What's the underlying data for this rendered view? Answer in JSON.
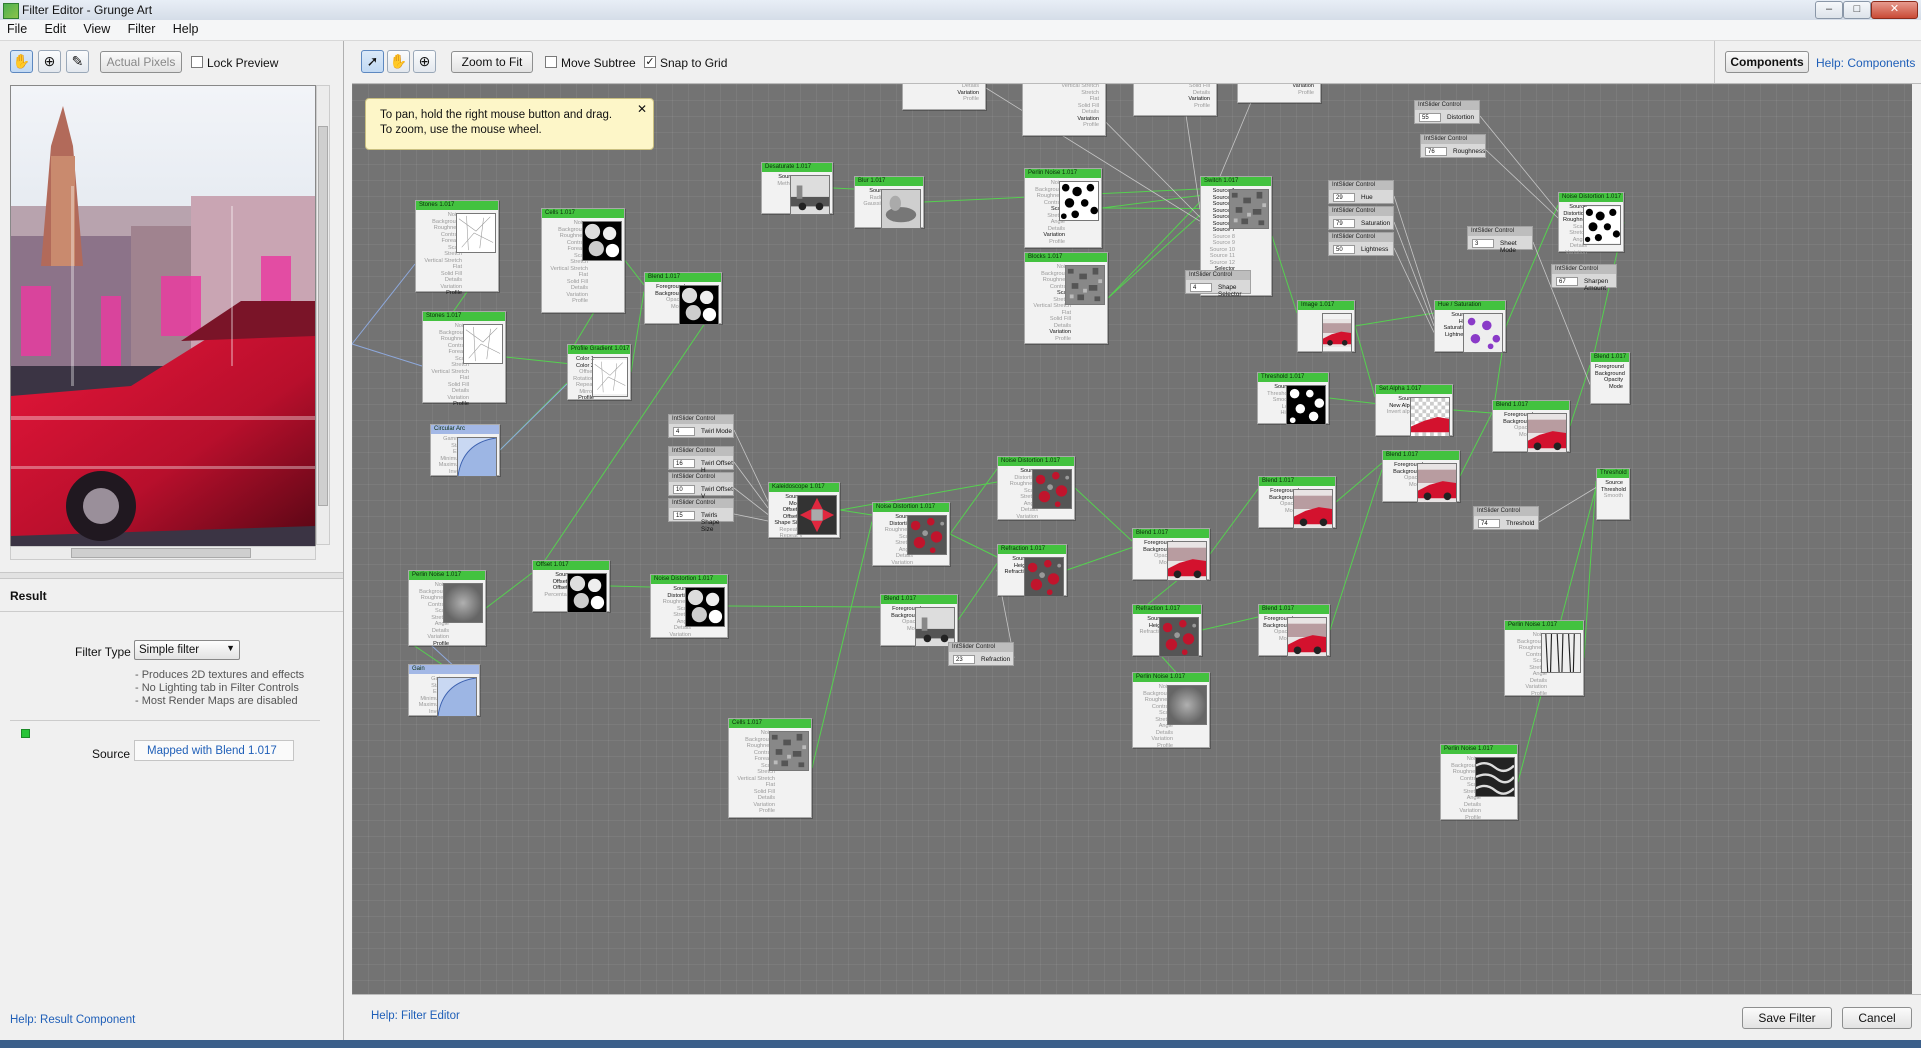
{
  "window": {
    "title": "Filter Editor - Grunge Art"
  },
  "menu": [
    "File",
    "Edit",
    "View",
    "Filter",
    "Help"
  ],
  "left_panel": {
    "actual_pixels": "Actual Pixels",
    "lock_preview": "Lock Preview",
    "result_heading": "Result",
    "filter_type_label": "Filter Type",
    "filter_type_value": "Simple filter",
    "filter_notes": [
      "- Produces 2D textures and effects",
      "- No Lighting tab in Filter Controls",
      "- Most Render Maps are disabled"
    ],
    "source_label": "Source",
    "source_value": "Mapped with Blend 1.017",
    "help_link": "Help: Result Component"
  },
  "editor_toolbar": {
    "zoom_to_fit": "Zoom to Fit",
    "move_subtree": "Move Subtree",
    "snap_to_grid": "Snap to Grid",
    "snap_checked": "✓",
    "components": "Components",
    "help_components": "Help: Components"
  },
  "tooltip": {
    "line1": "To pan, hold the right mouse button and drag.",
    "line2": "To zoom, use the mouse wheel."
  },
  "bottom": {
    "help": "Help: Filter Editor",
    "save": "Save Filter",
    "cancel": "Cancel"
  },
  "sliders": [
    {
      "id": "s1",
      "title": "IntSlider Control",
      "value": "55",
      "label": "Distortion"
    },
    {
      "id": "s2",
      "title": "IntSlider Control",
      "value": "76",
      "label": "Roughness"
    },
    {
      "id": "s3",
      "title": "IntSlider Control",
      "value": "29",
      "label": "Hue"
    },
    {
      "id": "s4",
      "title": "IntSlider Control",
      "value": "79",
      "label": "Saturation"
    },
    {
      "id": "s5",
      "title": "IntSlider Control",
      "value": "50",
      "label": "Lightness"
    },
    {
      "id": "s6",
      "title": "IntSlider Control",
      "value": "3",
      "label": "Sheet Mode"
    },
    {
      "id": "s7",
      "title": "IntSlider Control",
      "value": "67",
      "label": "Sharpen Amount"
    },
    {
      "id": "s8",
      "title": "IntSlider Control",
      "value": "4",
      "label": "Shape Selector"
    },
    {
      "id": "s9",
      "title": "IntSlider Control",
      "value": "4",
      "label": "Twirl Mode"
    },
    {
      "id": "s10",
      "title": "IntSlider Control",
      "value": "16",
      "label": "Twirl Offset H"
    },
    {
      "id": "s11",
      "title": "IntSlider Control",
      "value": "10",
      "label": "Twirl Offset V"
    },
    {
      "id": "s12",
      "title": "IntSlider Control",
      "value": "15",
      "label": "Twirls Shape Size"
    },
    {
      "id": "s13",
      "title": "IntSlider Control",
      "value": "23",
      "label": "Refraction"
    },
    {
      "id": "s14",
      "title": "IntSlider Control",
      "value": "74",
      "label": "Threshold"
    }
  ],
  "nodes": [
    {
      "id": "n1",
      "title": "Stones 1.017",
      "ports": [
        "Noise",
        "Background",
        "Roughness",
        "Contrast",
        "Foreach",
        "Scale",
        "Stretch",
        "Vertical Stretch",
        "Flat",
        "Solid Fill",
        "Details",
        "Variation",
        "Profile"
      ],
      "on": [
        12
      ],
      "thumb": "lines"
    },
    {
      "id": "n2",
      "title": "Stones 1.017",
      "ports": [
        "Noise",
        "Background",
        "Roughness",
        "Contrast",
        "Foreach",
        "Scale",
        "Stretch",
        "Vertical Stretch",
        "Flat",
        "Solid Fill",
        "Details",
        "Variation",
        "Profile"
      ],
      "on": [
        12
      ],
      "thumb": "lines"
    },
    {
      "id": "n3",
      "title": "Cells 1.017",
      "ports": [
        "Noise",
        "Background",
        "Roughness",
        "Contrast",
        "Foreach",
        "Scale",
        "Stretch",
        "Vertical Stretch",
        "Flat",
        "Solid Fill",
        "Details",
        "Variation",
        "Profile"
      ],
      "on": [],
      "thumb": "cells"
    },
    {
      "id": "n4",
      "title": "Blend 1.017",
      "ports": [
        "Foreground",
        "Background",
        "Opacity",
        "Mode"
      ],
      "on": [
        0,
        1
      ],
      "thumb": "cells"
    },
    {
      "id": "n5",
      "title": "Profile Gradient 1.017",
      "ports": [
        "Color 1",
        "Color 2",
        "Offset",
        "Rotation",
        "Repeat",
        "Mirror",
        "Profile"
      ],
      "on": [
        0,
        1,
        6
      ],
      "thumb": "lines"
    },
    {
      "id": "n6",
      "title": "Circular Arc",
      "ports": [
        "Gamma",
        "Start",
        "End",
        "Minimum",
        "Maximum",
        "Invert"
      ],
      "on": [],
      "thumb": "curve",
      "cls": "blue"
    },
    {
      "id": "n7",
      "title": "Desaturate 1.017",
      "ports": [
        "Source",
        "Method"
      ],
      "on": [
        0
      ],
      "thumb": "bw"
    },
    {
      "id": "n8",
      "title": "Blur 1.017",
      "ports": [
        "Source",
        "Radius",
        "Gaussian"
      ],
      "on": [
        0
      ],
      "thumb": "blur"
    },
    {
      "id": "n9",
      "title": "Perlin Noise 1.017",
      "ports": [
        "Noise",
        "Background",
        "Roughness",
        "Contrast",
        "Scale",
        "Stretch",
        "Angle",
        "Details",
        "Variation",
        "Profile"
      ],
      "on": [
        4,
        8
      ],
      "thumb": "noisebw"
    },
    {
      "id": "n10",
      "title": "Blocks 1.017",
      "ports": [
        "Noise",
        "Background",
        "Roughness",
        "Contrast",
        "Scale",
        "Stretch",
        "Vertical Stretch",
        "Flat",
        "Solid Fill",
        "Details",
        "Variation",
        "Profile"
      ],
      "on": [
        4,
        10
      ],
      "thumb": "noise"
    },
    {
      "id": "n11",
      "title": "Switch 1.017",
      "ports": [
        "Source 1",
        "Source 2",
        "Source 3",
        "Source 4",
        "Source 5",
        "Source 6",
        "Source 7",
        "Source 8",
        "Source 9",
        "Source 10",
        "Source 11",
        "Source 12",
        "Selector"
      ],
      "on": [
        0,
        1,
        2,
        3,
        4,
        5,
        6,
        12
      ],
      "thumb": "noise"
    },
    {
      "id": "n12",
      "title": "Image 1.017",
      "ports": [],
      "on": [],
      "thumb": "car"
    },
    {
      "id": "n13",
      "title": "Hue / Saturation",
      "ports": [
        "Source",
        "Hue",
        "Saturation",
        "Lightness"
      ],
      "on": [
        0,
        1,
        2,
        3
      ],
      "thumb": "purple"
    },
    {
      "id": "n14",
      "title": "Noise Distortion 1.017",
      "ports": [
        "Source",
        "Distortion",
        "Roughness",
        "Scale",
        "Stretch",
        "Angle",
        "Details",
        "Variation"
      ],
      "on": [
        0,
        1,
        2
      ],
      "thumb": "noisebw"
    },
    {
      "id": "n15",
      "title": "Threshold 1.017",
      "ports": [
        "Source",
        "Threshold",
        "Smooth",
        "Low",
        "High"
      ],
      "on": [
        0
      ],
      "thumb": "spots"
    },
    {
      "id": "n16",
      "title": "Set Alpha 1.017",
      "ports": [
        "Source",
        "New Alpha",
        "Invert alpha"
      ],
      "on": [
        0,
        1
      ],
      "thumb": "carcheck"
    },
    {
      "id": "n17",
      "title": "Blend 1.017",
      "ports": [
        "Foreground",
        "Background",
        "Opacity",
        "Mode"
      ],
      "on": [
        0,
        1
      ],
      "thumb": "car"
    },
    {
      "id": "n18",
      "title": "Blend 1.017",
      "ports": [
        "Foreground",
        "Background",
        "Opacity",
        "Mode"
      ],
      "on": [
        0,
        1
      ],
      "thumb": "car"
    },
    {
      "id": "n19",
      "title": "Blend 1.017",
      "ports": [
        "Foreground",
        "Background",
        "Opacity",
        "Mode"
      ],
      "on": [
        0,
        1
      ],
      "thumb": "car"
    },
    {
      "id": "n20",
      "title": "Kaleidoscope 1.017",
      "ports": [
        "Source",
        "Mode",
        "Offset H",
        "Offset V",
        "Shape Size",
        "Repeat H",
        "Repeat V"
      ],
      "on": [
        0,
        1,
        2,
        3,
        4
      ],
      "thumb": "kaleido"
    },
    {
      "id": "n21",
      "title": "Noise Distortion 1.017",
      "ports": [
        "Source",
        "Distortion",
        "Roughness",
        "Scale",
        "Stretch",
        "Angle",
        "Details",
        "Variation"
      ],
      "on": [
        0,
        1
      ],
      "thumb": "redgrunge"
    },
    {
      "id": "n22",
      "title": "Noise Distortion 1.017",
      "ports": [
        "Source",
        "Distortion",
        "Roughness",
        "Scale",
        "Stretch",
        "Angle",
        "Details",
        "Variation"
      ],
      "on": [
        0
      ],
      "thumb": "redgrunge"
    },
    {
      "id": "n23",
      "title": "Refraction 1.017",
      "ports": [
        "Source",
        "Height",
        "Refraction"
      ],
      "on": [
        0,
        1,
        2
      ],
      "thumb": "redgrunge"
    },
    {
      "id": "n24",
      "title": "Blend 1.017",
      "ports": [
        "Foreground",
        "Background",
        "Opacity",
        "Mode"
      ],
      "on": [
        0,
        1
      ],
      "thumb": "bw"
    },
    {
      "id": "n25",
      "title": "Blend 1.017",
      "ports": [
        "Foreground",
        "Background",
        "Opacity",
        "Mode"
      ],
      "on": [
        0,
        1
      ],
      "thumb": "car"
    },
    {
      "id": "n26",
      "title": "Blend 1.017",
      "ports": [
        "Foreground",
        "Background",
        "Opacity",
        "Mode"
      ],
      "on": [
        0,
        1
      ],
      "thumb": "car"
    },
    {
      "id": "n27",
      "title": "Refraction 1.017",
      "ports": [
        "Source",
        "Height",
        "Refraction"
      ],
      "on": [
        0,
        1
      ],
      "thumb": "redgrunge"
    },
    {
      "id": "n28",
      "title": "Perlin Noise 1.017",
      "ports": [
        "Noise",
        "Background",
        "Roughness",
        "Contrast",
        "Scale",
        "Stretch",
        "Angle",
        "Details",
        "Variation",
        "Profile"
      ],
      "on": [],
      "thumb": "gray"
    },
    {
      "id": "n29",
      "title": "Perlin Noise 1.017",
      "ports": [
        "Noise",
        "Background",
        "Roughness",
        "Contrast",
        "Scale",
        "Stretch",
        "Angle",
        "Details",
        "Variation",
        "Profile"
      ],
      "on": [],
      "thumb": "streaks"
    },
    {
      "id": "n30",
      "title": "Perlin Noise 1.017",
      "ports": [
        "Noise",
        "Background",
        "Roughness",
        "Contrast",
        "Scale",
        "Stretch",
        "Angle",
        "Details",
        "Variation",
        "Profile"
      ],
      "on": [],
      "thumb": "marble"
    },
    {
      "id": "n31",
      "title": "Perlin Noise 1.017",
      "ports": [
        "Noise",
        "Background",
        "Roughness",
        "Contrast",
        "Scale",
        "Stretch",
        "Angle",
        "Details",
        "Variation",
        "Profile"
      ],
      "on": [
        9
      ],
      "thumb": "gray"
    },
    {
      "id": "n32",
      "title": "Gain",
      "ports": [
        "Gain",
        "Start",
        "End",
        "Minimum",
        "Maximum",
        "Invert"
      ],
      "on": [],
      "thumb": "curve",
      "cls": "blue"
    },
    {
      "id": "n33",
      "title": "Offset 1.017",
      "ports": [
        "Source",
        "Offset H",
        "Offset V",
        "Percentage"
      ],
      "on": [
        0,
        1,
        2
      ],
      "thumb": "cells"
    },
    {
      "id": "n34",
      "title": "Noise Distortion 1.017",
      "ports": [
        "Source",
        "Distortion",
        "Roughness",
        "Scale",
        "Stretch",
        "Angle",
        "Details",
        "Variation"
      ],
      "on": [
        0,
        1
      ],
      "thumb": "cells"
    },
    {
      "id": "n35",
      "title": "Cells 1.017",
      "ports": [
        "Noise",
        "Background",
        "Roughness",
        "Contrast",
        "Foreach",
        "Scale",
        "Stretch",
        "Vertical Stretch",
        "Flat",
        "Solid Fill",
        "Details",
        "Variation",
        "Profile"
      ],
      "on": [],
      "thumb": "noise"
    },
    {
      "id": "n36",
      "title": "Blend 1.017",
      "ports": [
        "Foreground",
        "Background",
        "Opacity",
        "Mode"
      ],
      "on": [
        0,
        1,
        2,
        3
      ],
      "thumb": "none"
    },
    {
      "id": "n37",
      "title": "Threshold 1.017",
      "ports": [
        "Source",
        "Threshold",
        "Smooth"
      ],
      "on": [
        0,
        1
      ],
      "thumb": "none"
    }
  ],
  "top_partial_nodes": [
    {
      "id": "p1",
      "lines": [
        "Details",
        "Variation",
        "Profile"
      ],
      "on": [
        1
      ]
    },
    {
      "id": "p2",
      "lines": [
        "Vertical Stretch",
        "Stretch",
        "Flat",
        "Solid Fill",
        "Details",
        "Variation",
        "Profile"
      ],
      "on": [
        5
      ]
    },
    {
      "id": "p3",
      "lines": [
        "Solid Fill",
        "Details",
        "Variation",
        "Profile"
      ],
      "on": [
        2
      ]
    },
    {
      "id": "p4",
      "lines": [
        "Variation",
        "Profile"
      ],
      "on": [
        0
      ]
    }
  ]
}
